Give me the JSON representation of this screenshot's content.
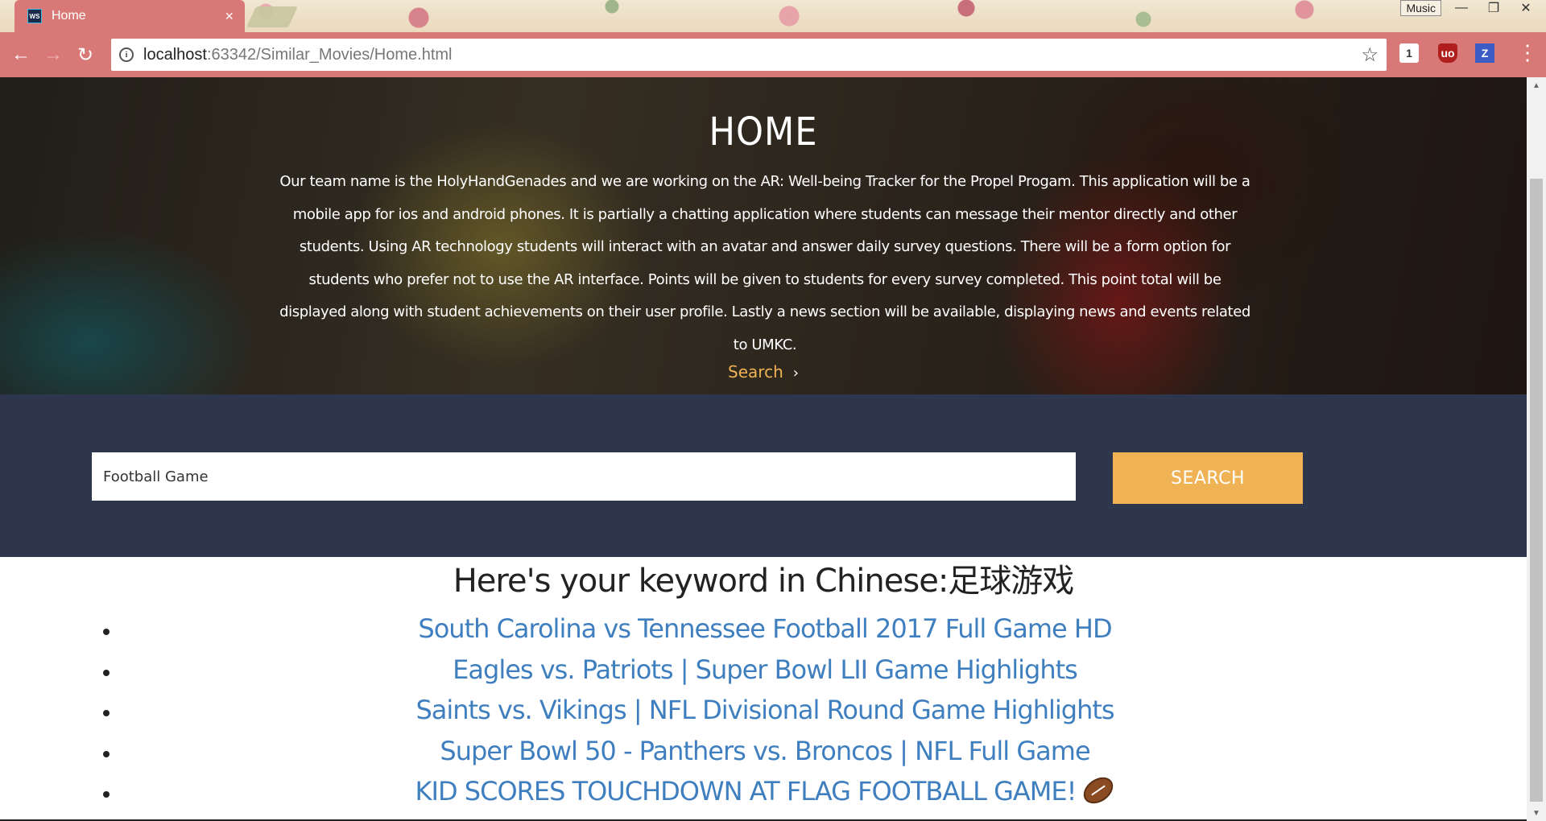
{
  "browser": {
    "tab_title": "Home",
    "tab_close": "×",
    "favicon_text": "WS",
    "profile_label": "Music",
    "window_controls": {
      "minimize": "—",
      "restore": "❐",
      "close": "✕"
    },
    "nav": {
      "back": "←",
      "forward": "→",
      "reload": "↻"
    },
    "url_host": "localhost",
    "url_path": ":63342/Similar_Movies/Home.html",
    "star": "☆",
    "extensions": [
      "1",
      "uo",
      "Z"
    ],
    "menu": "⋮"
  },
  "hero": {
    "title": "HOME",
    "description": "Our team name is the HolyHandGenades and we are working on the AR: Well-being Tracker for the Propel Progam. This application will be a mobile app for ios and android phones. It is partially a chatting application where students can message their mentor directly and other students. Using AR technology students will interact with an avatar and answer daily survey questions. There will be a form option for students who prefer not to use the AR interface. Points will be given to students for every survey completed. This point total will be displayed along with student achievements on their user profile. Lastly a news section will be available, displaying news and events related to UMKC.",
    "link_label": "Search",
    "link_chevron": "›"
  },
  "search": {
    "value": "Football Game",
    "button_label": "SEARCH"
  },
  "results": {
    "heading": "Here's your keyword in Chinese:足球游戏",
    "items": [
      "South Carolina vs Tennessee Football 2017 Full Game HD",
      "Eagles vs. Patriots | Super Bowl LII Game Highlights",
      "Saints vs. Vikings | NFL Divisional Round Game Highlights",
      "Super Bowl 50 - Panthers vs. Broncos | NFL Full Game",
      "KID SCORES TOUCHDOWN AT FLAG FOOTBALL GAME!"
    ]
  },
  "colors": {
    "chrome": "#d87978",
    "accent": "#efb356",
    "band": "#2d364c",
    "link": "#3f7fbf"
  }
}
